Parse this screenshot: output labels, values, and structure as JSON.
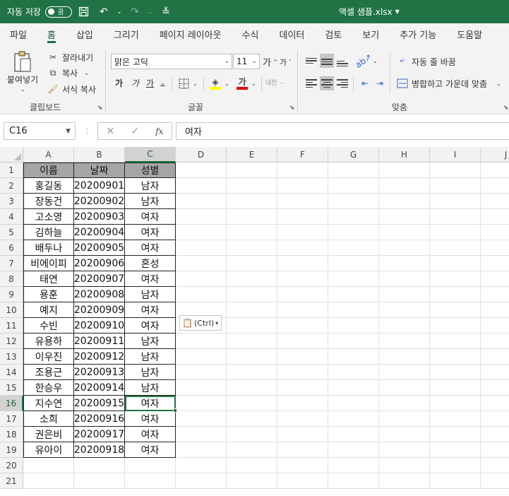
{
  "titlebar": {
    "autosave_label": "자동 저장",
    "autosave_state": "끔",
    "document_title": "액셀 샘플.xlsx",
    "brand_color": "#217346"
  },
  "menu": [
    "파일",
    "홈",
    "삽입",
    "그리기",
    "페이지 레이아웃",
    "수식",
    "데이터",
    "검토",
    "보기",
    "추가 기능",
    "도움말"
  ],
  "menu_active": "홈",
  "ribbon": {
    "clipboard": {
      "paste_label": "붙여넣기",
      "cut_label": "잘라내기",
      "copy_label": "복사",
      "format_painter_label": "서식 복사",
      "group_label": "클립보드"
    },
    "font": {
      "font_name": "맑은 고딕",
      "font_size": "11",
      "grow_label": "가",
      "shrink_label": "가",
      "bold_label": "가",
      "italic_label": "가",
      "underline_label": "가",
      "font_color_label": "가",
      "phonetic_label": "내천",
      "group_label": "글꼴"
    },
    "alignment": {
      "wrap_text_label": "자동 줄 바꿈",
      "merge_center_label": "병합하고 가운데 맞춤",
      "group_label": "맞춤"
    }
  },
  "formula_bar": {
    "name_box": "C16",
    "content": "여자",
    "fx_label": "fx"
  },
  "sheet": {
    "columns": [
      "A",
      "B",
      "C",
      "D",
      "E",
      "F",
      "G",
      "H",
      "I",
      "J"
    ],
    "selected_column": "C",
    "selected_row": 16,
    "row_numbers": [
      1,
      2,
      3,
      4,
      5,
      6,
      7,
      8,
      9,
      10,
      11,
      12,
      13,
      14,
      15,
      16,
      17,
      18,
      19,
      20,
      21
    ],
    "rows": [
      [
        "이름",
        "날짜",
        "성별"
      ],
      [
        "홍길동",
        "20200901",
        "남자"
      ],
      [
        "장동건",
        "20200902",
        "남자"
      ],
      [
        "고소영",
        "20200903",
        "여자"
      ],
      [
        "김하늘",
        "20200904",
        "여자"
      ],
      [
        "배두나",
        "20200905",
        "여자"
      ],
      [
        "비에이피",
        "20200906",
        "혼성"
      ],
      [
        "태연",
        "20200907",
        "여자"
      ],
      [
        "용훈",
        "20200908",
        "남자"
      ],
      [
        "예지",
        "20200909",
        "여자"
      ],
      [
        "수빈",
        "20200910",
        "여자"
      ],
      [
        "유용하",
        "20200911",
        "남자"
      ],
      [
        "이우진",
        "20200912",
        "남자"
      ],
      [
        "조용근",
        "20200913",
        "남자"
      ],
      [
        "한승우",
        "20200914",
        "남자"
      ],
      [
        "지수연",
        "20200915",
        "여자"
      ],
      [
        "소희",
        "20200916",
        "여자"
      ],
      [
        "권은비",
        "20200917",
        "여자"
      ],
      [
        "유아이",
        "20200918",
        "여자"
      ]
    ]
  },
  "paste_options_label": "(Ctrl)"
}
